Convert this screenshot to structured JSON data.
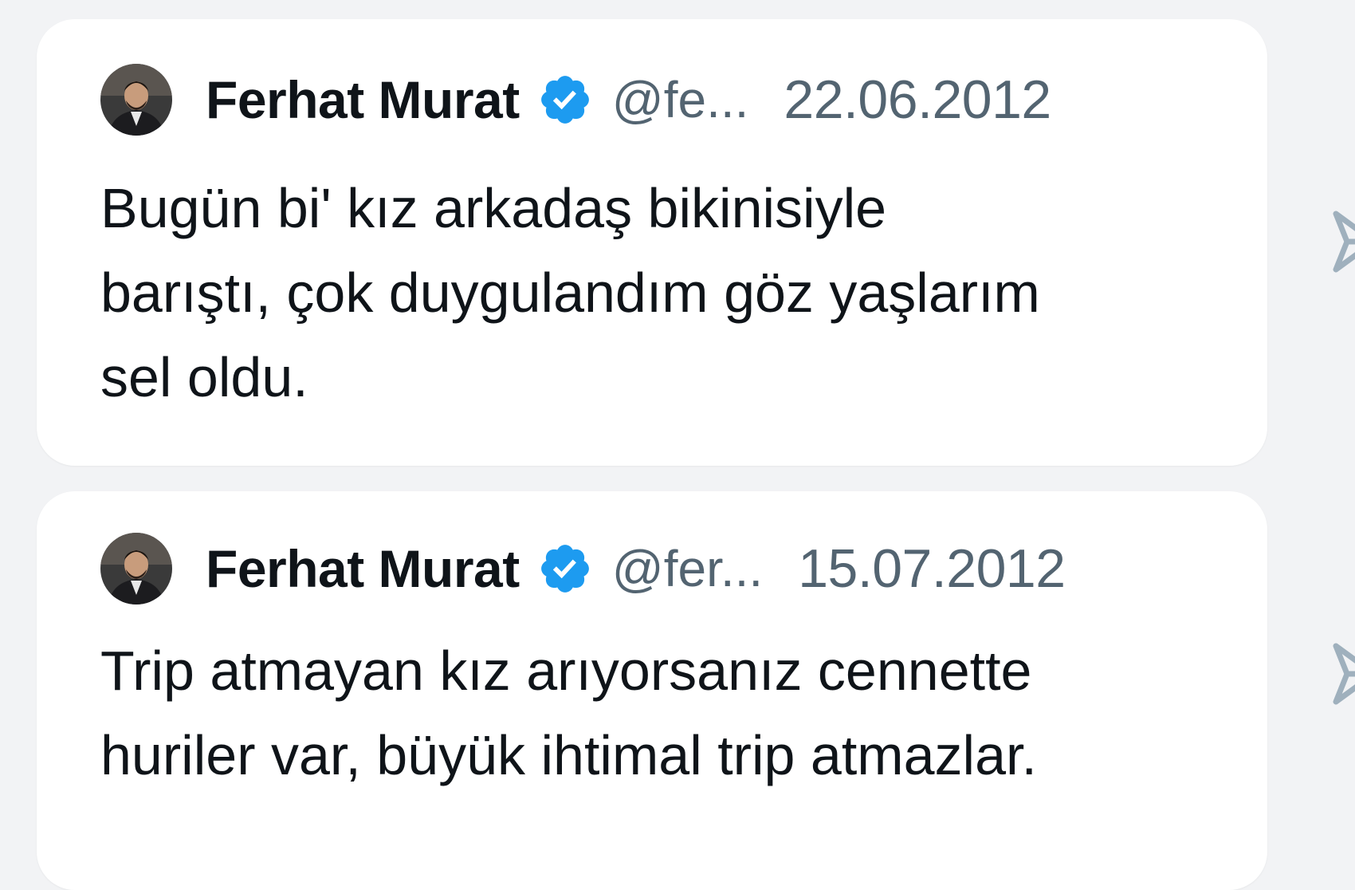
{
  "colors": {
    "background": "#f2f3f5",
    "card": "#ffffff",
    "text_primary": "#0f1419",
    "text_secondary": "#536471",
    "verified_blue": "#1d9bf0"
  },
  "tweets": [
    {
      "author_name": "Ferhat Murat",
      "verified_icon": "verified-badge-icon",
      "handle": "@fe...",
      "date": "22.06.2012",
      "text": "Bugün bi' kız arkadaş bikinisiyle\nbarıştı, çok duygulandım göz yaşlarım\nsel oldu."
    },
    {
      "author_name": "Ferhat Murat",
      "verified_icon": "verified-badge-icon",
      "handle": "@fer...",
      "date": "15.07.2012",
      "text": "Trip atmayan kız arıyorsanız cennette\nhuriler var, büyük ihtimal trip atmazlar."
    }
  ],
  "side_icons": [
    "share-icon",
    "share-icon"
  ]
}
